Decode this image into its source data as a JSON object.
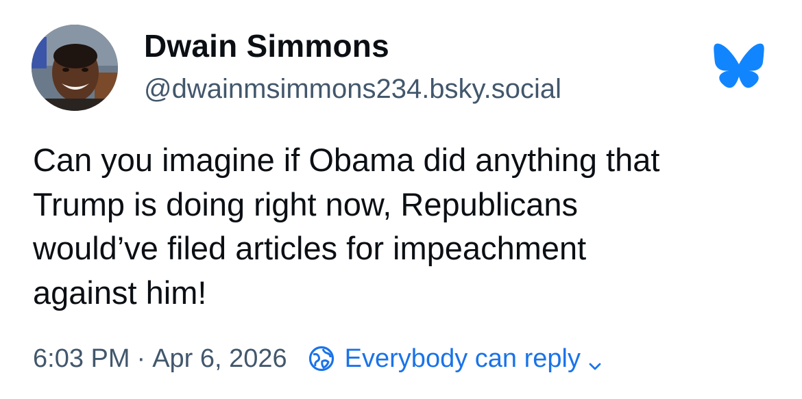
{
  "author": {
    "display_name": "Dwain Simmons",
    "handle": "@dwainmsimmons234.bsky.social",
    "avatar_icon": "profile-photo"
  },
  "logo": {
    "icon": "bluesky-butterfly-icon",
    "color": "#1185fe"
  },
  "post": {
    "text": "Can you imagine if Obama did anything that\nTrump is doing right now, Republicans\nwould’ve filed articles for impeachment\nagainst him!"
  },
  "meta": {
    "time": "6:03 PM",
    "separator": "·",
    "date": "Apr 6, 2026",
    "reply_setting_icon": "globe-icon",
    "reply_setting_label": "Everybody can reply",
    "reply_setting_chevron": "chevron-down-icon"
  },
  "colors": {
    "text_primary": "#0b0f14",
    "text_secondary": "#42576c",
    "accent": "#1a73e8"
  }
}
